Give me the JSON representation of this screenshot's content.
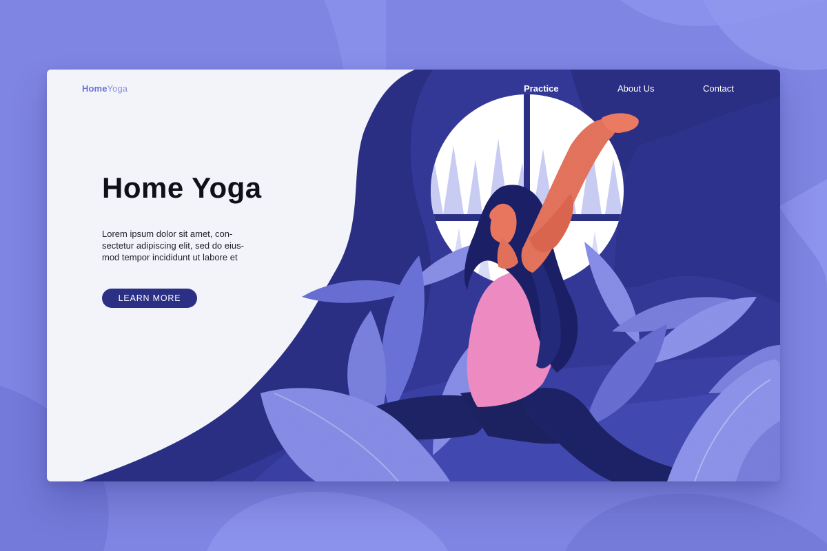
{
  "brand": {
    "logo_strong": "Home",
    "logo_light": "Yoga"
  },
  "nav": {
    "items": [
      {
        "label": "Practice",
        "active": true
      },
      {
        "label": "About Us",
        "active": false
      },
      {
        "label": "Contact",
        "active": false
      }
    ]
  },
  "hero": {
    "title": "Home Yoga",
    "text_lines": [
      "Lorem ipsum dolor sit amet, con-",
      "sectetur adipiscing elit, sed do eius-",
      "mod tempor incididunt ut labore et"
    ],
    "cta_label": "LEARN MORE"
  },
  "colors": {
    "background": "#7f86e3",
    "card": "#f3f4f9",
    "navy": "#2b3085",
    "deep_navy": "#232872",
    "accent_pink": "#f48fc6",
    "skin": "#e8755e",
    "leaf": "#8389e6"
  }
}
